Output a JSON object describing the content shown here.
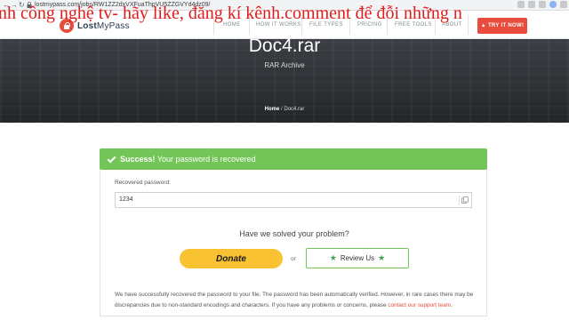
{
  "browser": {
    "url": "lostmypass.com/jobs/RW1ZZ2dxVXFuaThpVU5ZZGVYd4dz09/",
    "back_glyph": "←",
    "forward_glyph": "→",
    "reload_glyph": "↻"
  },
  "overlay_caption": "nh công nghệ tv- hãy like, đăng kí kênh.comment để đỗi những n",
  "header": {
    "logo_text_bold": "Lost",
    "logo_text_rest": "MyPass",
    "nav": [
      "HOME",
      "HOW IT WORKS",
      "FILE TYPES",
      "PRICING",
      "FREE TOOLS",
      "ABOUT"
    ],
    "try_button": "TRY IT NOW!",
    "brand_color": "#e74c3c"
  },
  "hero": {
    "title": "Doc4.rar",
    "subtitle": "RAR Archive",
    "breadcrumb_home": "Home",
    "breadcrumb_sep": " / ",
    "breadcrumb_current": "Doc4.rar"
  },
  "result": {
    "success_bold": "Success!",
    "success_text": " Your password is recovered",
    "success_color": "#73c557",
    "password_label": "Recovered password:",
    "password_value": "1234",
    "solved_question": "Have we solved your problem?",
    "donate_label": "Donate",
    "or_text": "or",
    "review_label": "Review Us",
    "footnote": "We have successfully recovered the password to your file. The password has been automatically verified. However, in rare cases there may be discrepancies due to non-standard encodings and characters. If you have any problems or concerns, please ",
    "support_link": "contact our support team",
    "footnote_end": "."
  }
}
